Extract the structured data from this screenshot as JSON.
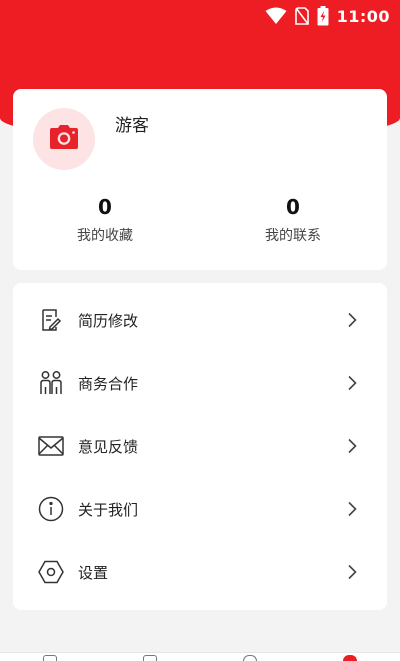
{
  "status_bar": {
    "time": "11:00"
  },
  "profile": {
    "username": "游客",
    "stats": [
      {
        "value": "0",
        "label": "我的收藏"
      },
      {
        "value": "0",
        "label": "我的联系"
      }
    ]
  },
  "menu": {
    "items": [
      {
        "label": "简历修改",
        "icon": "resume-edit-icon"
      },
      {
        "label": "商务合作",
        "icon": "people-icon"
      },
      {
        "label": "意见反馈",
        "icon": "mail-icon"
      },
      {
        "label": "关于我们",
        "icon": "info-icon"
      },
      {
        "label": "设置",
        "icon": "settings-hexagon-icon"
      }
    ]
  },
  "colors": {
    "header_red": "#ee1d23",
    "avatar_bg": "#fde3e3",
    "page_bg": "#f3f3f3"
  }
}
